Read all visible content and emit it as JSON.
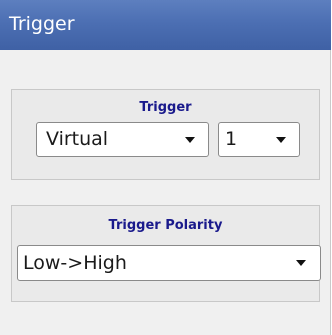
{
  "header": {
    "title": "Trigger"
  },
  "trigger_group": {
    "title": "Trigger",
    "source_select": {
      "value": "Virtual"
    },
    "channel_select": {
      "value": "1"
    }
  },
  "polarity_group": {
    "title": "Trigger Polarity",
    "polarity_select": {
      "value": "Low->High"
    }
  },
  "icons": {
    "dropdown": "chevron-down-icon"
  },
  "colors": {
    "titlebar": "#4c6fb3",
    "group_title": "#1a1a8c",
    "panel_background": "#f0f0f0"
  }
}
